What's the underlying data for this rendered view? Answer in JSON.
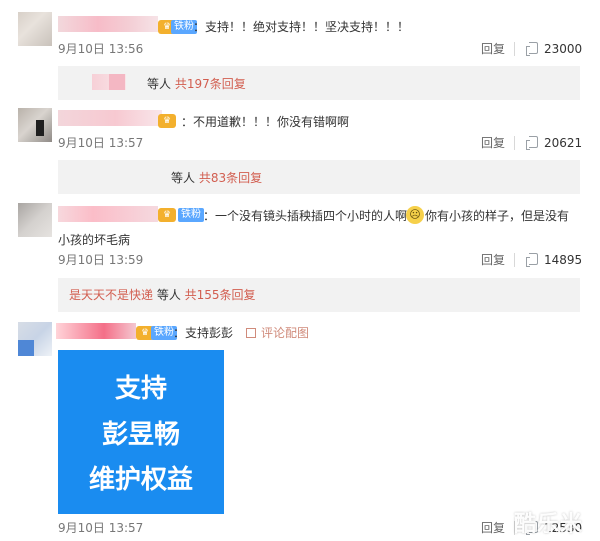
{
  "comments": [
    {
      "badge_text": "铁粉",
      "text": "：支持！！绝对支持！！坚决支持！！！",
      "time": "9月10日 13:56",
      "reply_label": "回复",
      "likes": "23000",
      "reply_summary": {
        "prefix": "等人 ",
        "count_text": "共197条回复"
      }
    },
    {
      "text": "：不用道歉！！！你没有错啊啊",
      "time": "9月10日 13:57",
      "reply_label": "回复",
      "likes": "20621",
      "reply_summary": {
        "prefix": "等人 ",
        "count_text": "共83条回复"
      }
    },
    {
      "badge_text": "铁粉",
      "text_line1": "：一个没有镜头插秧插四个小时的人啊",
      "text_line2": "你有小孩的样子，但是没有",
      "text_line3": "小孩的坏毛病",
      "time": "9月10日 13:59",
      "reply_label": "回复",
      "likes": "14895",
      "reply_summary": {
        "name": "是天天不是快递",
        "prefix": " 等人 ",
        "count_text": "共155条回复"
      }
    },
    {
      "badge_text": "铁粉",
      "text": "：支持彭彭",
      "image_link": "评论配图",
      "image_text": [
        "支持",
        "彭昱畅",
        "维护权益"
      ],
      "time": "9月10日 13:57",
      "reply_label": "回复",
      "likes": "12530"
    }
  ],
  "watermark": "酷乐米",
  "icons": [
    "crown-icon",
    "like-icon",
    "image-icon",
    "emoji-icon"
  ],
  "colors": {
    "fan_badge": "#5aa7ff",
    "accent": "#d25e50",
    "poster": "#1a8cf0"
  }
}
